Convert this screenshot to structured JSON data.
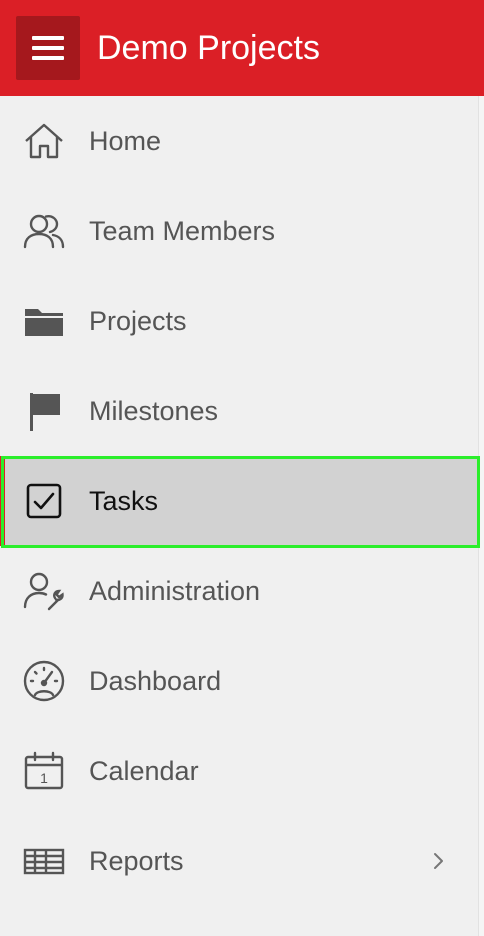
{
  "header": {
    "app_title": "Demo Projects",
    "menu_icon": "hamburger-icon",
    "background_color": "#db1f26",
    "menu_button_color": "#a5181d"
  },
  "nav": {
    "items": [
      {
        "label": "Home",
        "icon": "home-icon",
        "active": false
      },
      {
        "label": "Team Members",
        "icon": "users-icon",
        "active": false
      },
      {
        "label": "Projects",
        "icon": "folder-icon",
        "active": false
      },
      {
        "label": "Milestones",
        "icon": "flag-icon",
        "active": false
      },
      {
        "label": "Tasks",
        "icon": "checkbox-checked-icon",
        "active": true
      },
      {
        "label": "Administration",
        "icon": "user-wrench-icon",
        "active": false
      },
      {
        "label": "Dashboard",
        "icon": "gauge-icon",
        "active": false
      },
      {
        "label": "Calendar",
        "icon": "calendar-icon",
        "active": false,
        "icon_text": "1"
      },
      {
        "label": "Reports",
        "icon": "table-icon",
        "active": false,
        "has_submenu": true,
        "submenu_icon": "chevron-right-icon"
      }
    ],
    "active_color": "#d2d2d2",
    "focus_color": "#2bee2b"
  }
}
